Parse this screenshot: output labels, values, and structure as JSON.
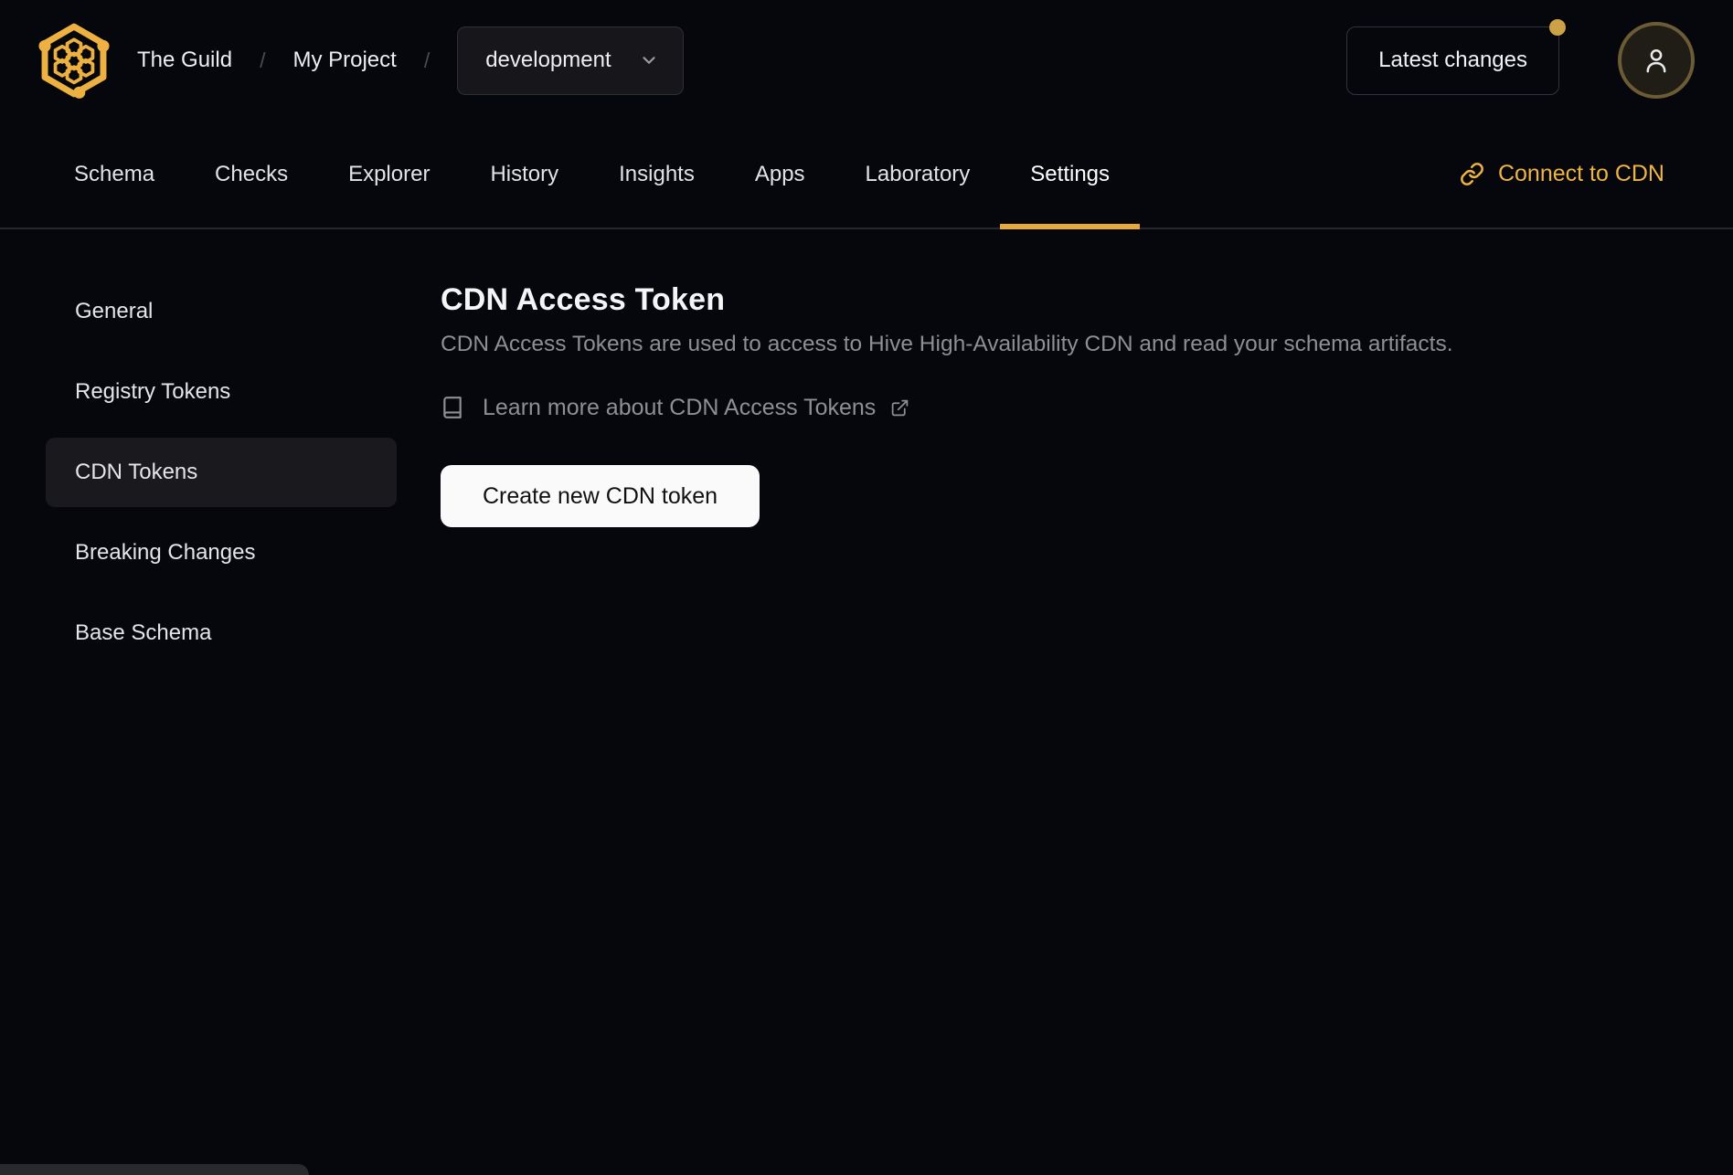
{
  "colors": {
    "accent_gold": "#efb440",
    "underline_gold": "#e5aa3c",
    "background": "#05070d",
    "surface": "#17171b",
    "selected_surface": "#1a1a1e",
    "muted_text": "#8f8e91",
    "button_bg": "#fafafa"
  },
  "header": {
    "breadcrumb": {
      "org": "The Guild",
      "separator": "/",
      "project": "My Project"
    },
    "target_selector": {
      "value": "development"
    },
    "latest_changes": {
      "label": "Latest changes",
      "has_notification_dot": true
    }
  },
  "nav": {
    "tabs": [
      {
        "label": "Schema",
        "active": false
      },
      {
        "label": "Checks",
        "active": false
      },
      {
        "label": "Explorer",
        "active": false
      },
      {
        "label": "History",
        "active": false
      },
      {
        "label": "Insights",
        "active": false
      },
      {
        "label": "Apps",
        "active": false
      },
      {
        "label": "Laboratory",
        "active": false
      },
      {
        "label": "Settings",
        "active": true
      }
    ],
    "connect_cdn": {
      "label": "Connect to CDN"
    }
  },
  "sidebar": {
    "items": [
      {
        "label": "General",
        "active": false
      },
      {
        "label": "Registry Tokens",
        "active": false
      },
      {
        "label": "CDN Tokens",
        "active": true
      },
      {
        "label": "Breaking Changes",
        "active": false
      },
      {
        "label": "Base Schema",
        "active": false
      }
    ]
  },
  "main": {
    "title": "CDN Access Token",
    "description": "CDN Access Tokens are used to access to Hive High-Availability CDN and read your schema artifacts.",
    "learn_more": {
      "label": "Learn more about CDN Access Tokens"
    },
    "create_token_button": {
      "label": "Create new CDN token"
    }
  }
}
